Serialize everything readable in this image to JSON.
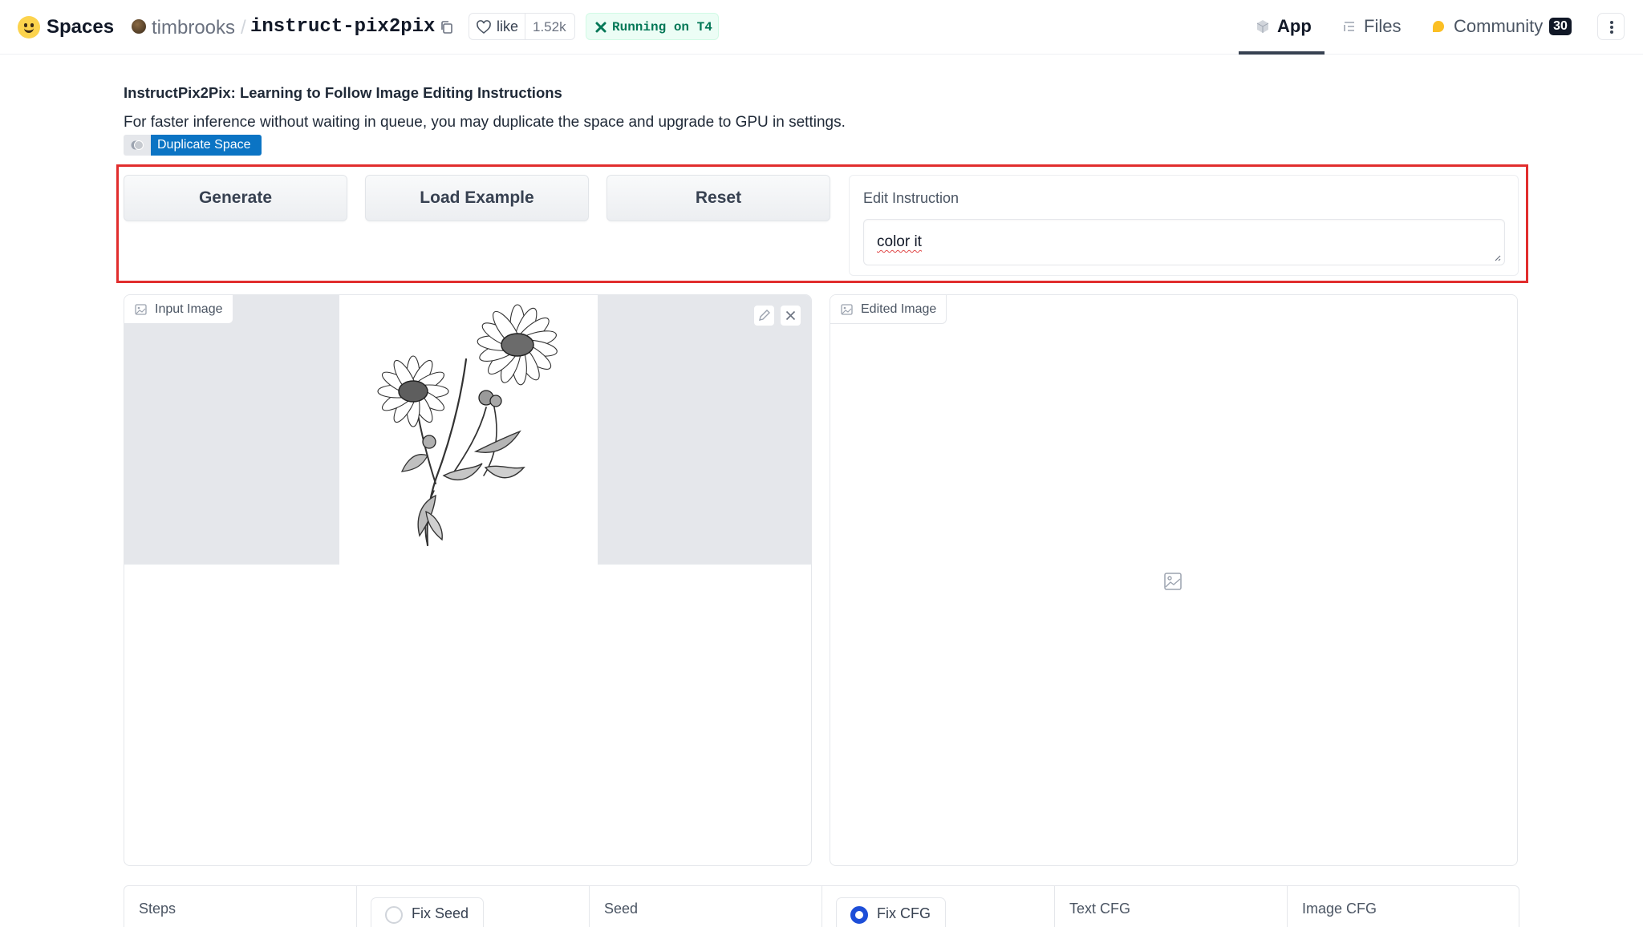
{
  "header": {
    "spaces_label": "Spaces",
    "owner": "timbrooks",
    "separator": "/",
    "repo": "instruct-pix2pix",
    "like_label": "like",
    "like_count": "1.52k",
    "status": "Running on T4",
    "tabs": [
      {
        "label": "App",
        "icon": "app-cube-icon",
        "active": true
      },
      {
        "label": "Files",
        "icon": "files-icon",
        "active": false
      },
      {
        "label": "Community",
        "icon": "community-icon",
        "active": false,
        "badge": "30"
      }
    ],
    "colors": {
      "status_green": "#047857",
      "accent_red": "#e12d2d",
      "duplicate_blue": "#0b74c4"
    }
  },
  "intro": {
    "title": "InstructPix2Pix: Learning to Follow Image Editing Instructions",
    "description": "For faster inference without waiting in queue, you may duplicate the space and upgrade to GPU in settings.",
    "duplicate_label": "Duplicate Space"
  },
  "controls": {
    "generate_label": "Generate",
    "load_example_label": "Load Example",
    "reset_label": "Reset",
    "edit_instruction_label": "Edit Instruction",
    "edit_instruction_value": "color it"
  },
  "panels": {
    "input_label": "Input Image",
    "output_label": "Edited Image"
  },
  "params": {
    "steps_label": "Steps",
    "fix_seed_label": "Fix Seed",
    "fix_seed_checked": false,
    "seed_label": "Seed",
    "fix_cfg_label": "Fix CFG",
    "fix_cfg_checked": true,
    "text_cfg_label": "Text CFG",
    "image_cfg_label": "Image CFG"
  }
}
